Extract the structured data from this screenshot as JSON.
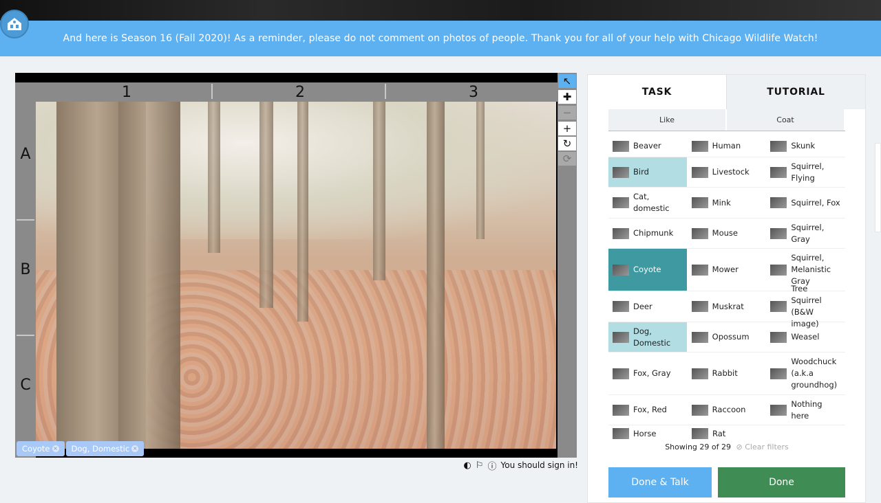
{
  "banner": {
    "text": "And here is Season 16 (Fall 2020)! As a reminder, please do not comment on photos of people. Thank you for all of your help with Chicago Wildlife Watch!"
  },
  "viewer": {
    "columns": [
      "1",
      "2",
      "3"
    ],
    "rows": [
      "A",
      "B",
      "C"
    ],
    "tools": [
      {
        "name": "pointer-icon",
        "glyph": "↖",
        "state": "active"
      },
      {
        "name": "move-icon",
        "glyph": "✚",
        "state": "normal"
      },
      {
        "name": "zoom-out-icon",
        "glyph": "−",
        "state": "disabled"
      },
      {
        "name": "zoom-in-icon",
        "glyph": "+",
        "state": "normal"
      },
      {
        "name": "rotate-icon",
        "glyph": "↻",
        "state": "normal"
      },
      {
        "name": "reset-icon",
        "glyph": "⟳",
        "state": "disabled"
      }
    ],
    "tags": [
      {
        "label": "Coyote"
      },
      {
        "label": "Dog, Domestic"
      }
    ],
    "sign_in_text": "You should sign in!"
  },
  "panel": {
    "tabs": {
      "task": "TASK",
      "tutorial": "TUTORIAL"
    },
    "filters": {
      "like": "Like",
      "coat": "Coat"
    },
    "species": [
      [
        "Beaver",
        "Human",
        "Skunk"
      ],
      [
        "Bird",
        "Livestock",
        "Squirrel, Flying"
      ],
      [
        "Cat, domestic",
        "Mink",
        "Squirrel, Fox"
      ],
      [
        "Chipmunk",
        "Mouse",
        "Squirrel, Gray"
      ],
      [
        "Coyote",
        "Mower",
        "Squirrel, Melanistic Gray"
      ],
      [
        "Deer",
        "Muskrat",
        "Tree Squirrel (B&W image)"
      ],
      [
        "Dog, Domestic",
        "Opossum",
        "Weasel"
      ],
      [
        "Fox, Gray",
        "Rabbit",
        "Woodchuck (a.k.a groundhog)"
      ],
      [
        "Fox, Red",
        "Raccoon",
        "Nothing here"
      ],
      [
        "Horse",
        "Rat",
        ""
      ]
    ],
    "showing": "Showing 29 of 29",
    "clear_filters": "Clear filters",
    "done_talk": "Done & Talk",
    "done": "Done"
  }
}
